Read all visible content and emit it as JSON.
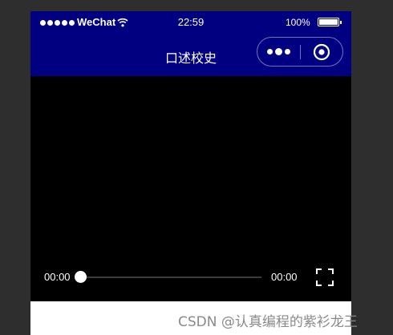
{
  "status_bar": {
    "carrier": "WeChat",
    "time": "22:59",
    "battery_percent": "100%",
    "battery_level": 1.0
  },
  "navbar": {
    "title": "口述校史",
    "more_icon": "more-dots-icon",
    "close_icon": "target-close-icon"
  },
  "video": {
    "current_time": "00:00",
    "duration": "00:00",
    "progress": 0,
    "fullscreen_icon": "fullscreen-icon"
  },
  "watermark": "CSDN @认真编程的紫衫龙王",
  "colors": {
    "navbar_bg": "#000080",
    "video_bg": "#000000",
    "page_bg": "#2e2e2e",
    "track": "#3a3a3a"
  }
}
